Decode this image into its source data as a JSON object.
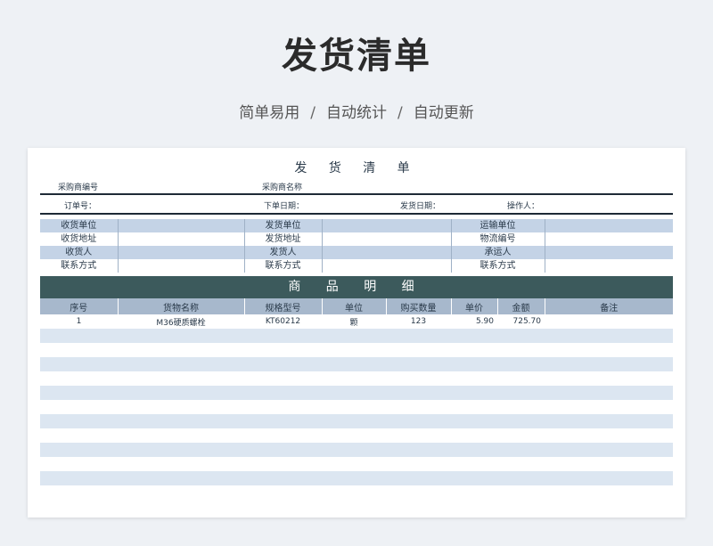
{
  "page": {
    "title": "发货清单",
    "subtitle_parts": [
      "简单易用",
      "自动统计",
      "自动更新"
    ],
    "separator": "/"
  },
  "sheet": {
    "title": "发 货 清 单",
    "buyer_code_label": "采购商编号",
    "buyer_name_label": "采购商名称",
    "order_no_label": "订单号：",
    "order_date_label": "下单日期：",
    "ship_date_label": "发货日期：",
    "operator_label": "操作人：",
    "info_rows": [
      [
        "收货单位",
        "",
        "发货单位",
        "",
        "运输单位",
        ""
      ],
      [
        "收货地址",
        "",
        "发货地址",
        "",
        "物流编号",
        ""
      ],
      [
        "收货人",
        "",
        "发货人",
        "",
        "承运人",
        ""
      ],
      [
        "联系方式",
        "",
        "联系方式",
        "",
        "联系方式",
        ""
      ]
    ],
    "section_title": "商 品 明 细",
    "columns": [
      "序号",
      "货物名称",
      "规格型号",
      "单位",
      "购买数量",
      "单价",
      "金额",
      "备注"
    ],
    "rows": [
      [
        "1",
        "M36硬质螺栓",
        "KT60212",
        "颗",
        "123",
        "5.90",
        "725.70",
        ""
      ],
      [
        "",
        "",
        "",
        "",
        "",
        "",
        "",
        ""
      ],
      [
        "",
        "",
        "",
        "",
        "",
        "",
        "",
        ""
      ],
      [
        "",
        "",
        "",
        "",
        "",
        "",
        "",
        ""
      ],
      [
        "",
        "",
        "",
        "",
        "",
        "",
        "",
        ""
      ],
      [
        "",
        "",
        "",
        "",
        "",
        "",
        "",
        ""
      ],
      [
        "",
        "",
        "",
        "",
        "",
        "",
        "",
        ""
      ],
      [
        "",
        "",
        "",
        "",
        "",
        "",
        "",
        ""
      ],
      [
        "",
        "",
        "",
        "",
        "",
        "",
        "",
        ""
      ],
      [
        "",
        "",
        "",
        "",
        "",
        "",
        "",
        ""
      ],
      [
        "",
        "",
        "",
        "",
        "",
        "",
        "",
        ""
      ],
      [
        "",
        "",
        "",
        "",
        "",
        "",
        "",
        ""
      ],
      [
        "",
        "",
        "",
        "",
        "",
        "",
        "",
        ""
      ]
    ]
  },
  "colors": {
    "header_band": "#3c5a5c",
    "column_header": "#a7b8cc",
    "stripe": "#dce6f1",
    "info_blue": "#c4d3e6"
  }
}
